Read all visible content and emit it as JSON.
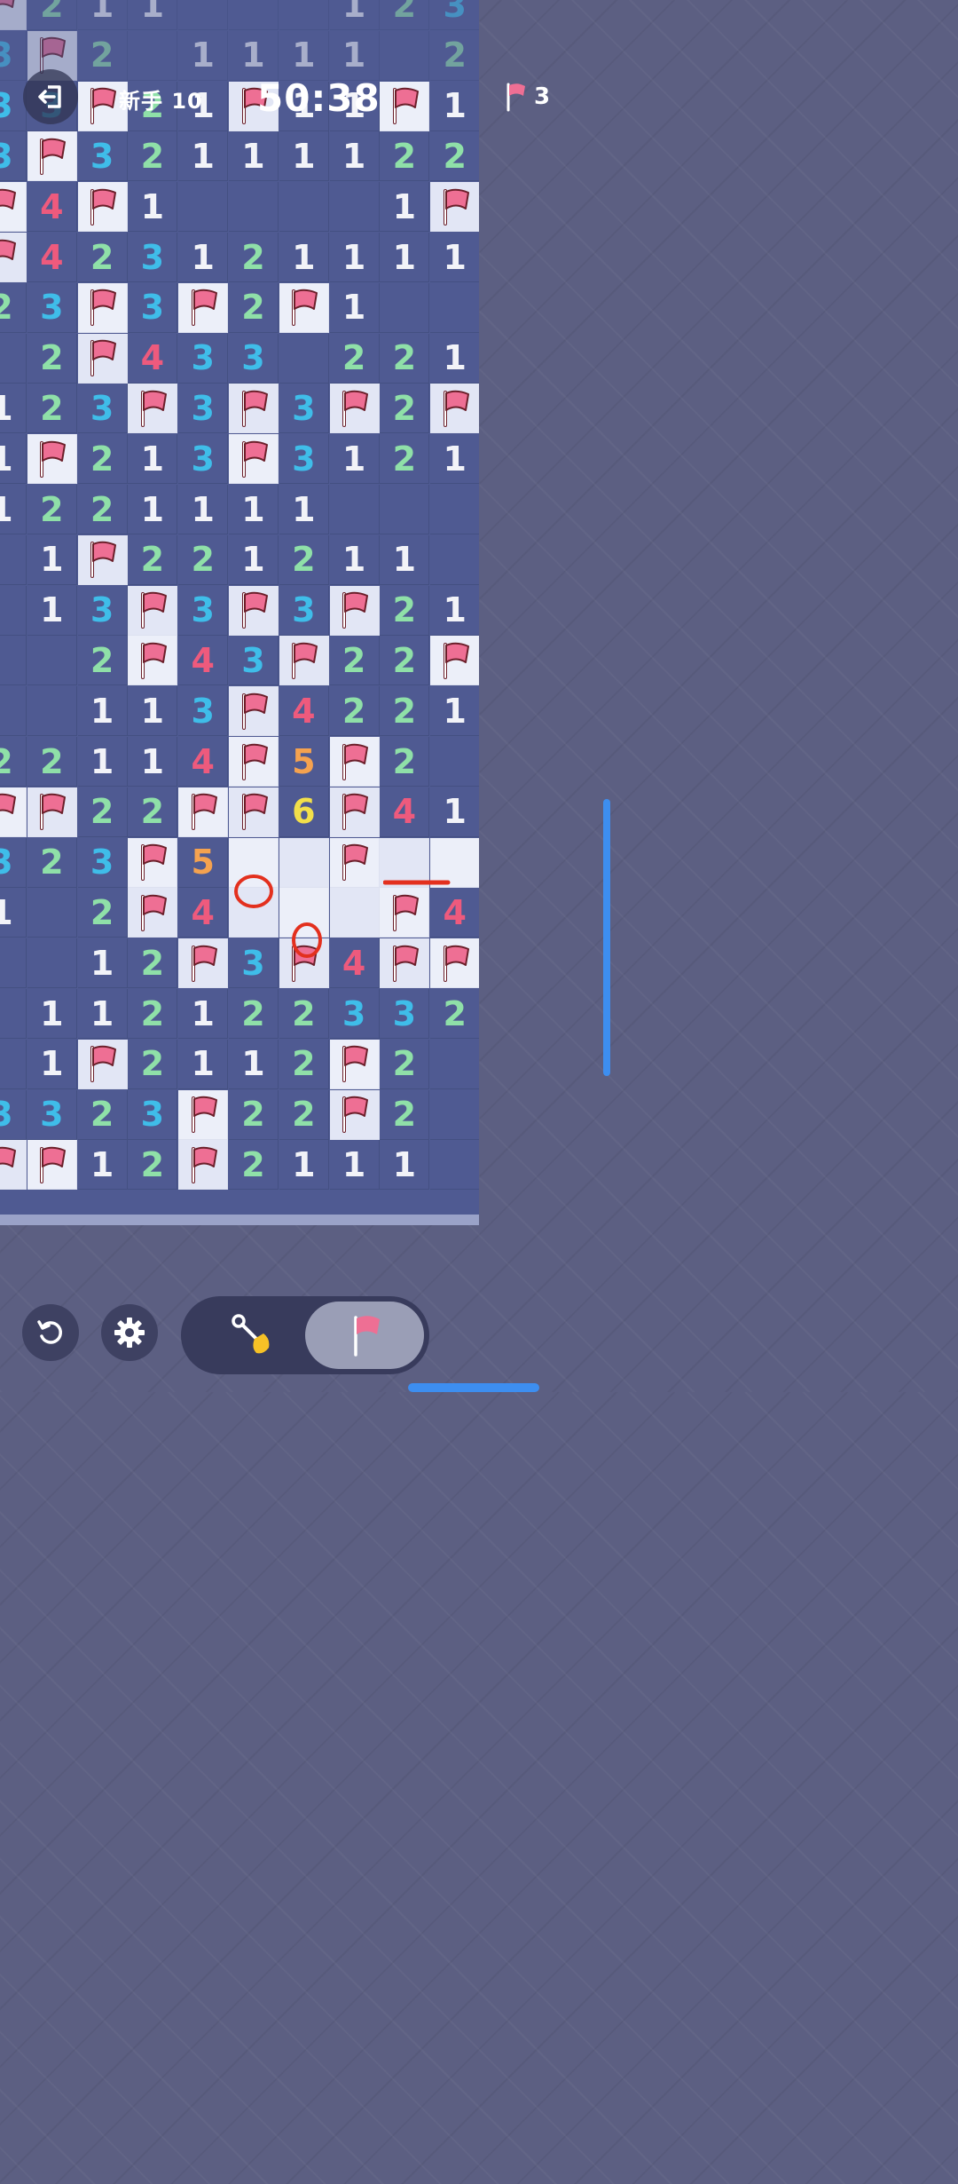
{
  "header": {
    "difficulty": "新手 10",
    "timer": "50:38",
    "flags_remaining": "3"
  },
  "board": {
    "cols": 10,
    "rows": 24,
    "legend": "F = flag, C = unopened cell, . = opened empty, digit = opened number",
    "rows_data": [
      "F211...123F",
      "3F2.1111.22",
      "33F21F11F1",
      "3F32111122",
      "F4F1....1F",
      "F423121111",
      "23F3F2F1..",
      ".2F433.221",
      "123F3F3F2F",
      "1F213F3121",
      "1221111...",
      ".1F221211.",
      ".13F3F3F21",
      "..2F43F22F",
      "..113F4221",
      "22114F5F2.",
      "FF22FF6F41",
      "323F5CCFCC",
      "1.2F4CCCF4",
      "..12F3F4FF",
      ".1121223 32",
      ".1F2112F2.",
      "3323F22F2.",
      "FF12F2111."
    ]
  },
  "annotations": [
    {
      "type": "circle",
      "color": "#e3301e"
    },
    {
      "type": "circle",
      "color": "#e3301e"
    },
    {
      "type": "dash",
      "color": "#e3301e"
    }
  ],
  "toolbar": {
    "restart": "restart",
    "settings": "settings",
    "dig_mode": "dig",
    "flag_mode": "flag"
  },
  "colors": {
    "board": "#4f5a92",
    "unopened": "#eceff9",
    "flag": "#ee6f94",
    "n1": "#f2f3f8",
    "n2": "#8fe0a8",
    "n3": "#3fbde9",
    "n4": "#ee5a7d",
    "n5": "#f5a24f",
    "n6": "#f3e04a",
    "accent": "#3d8ef0"
  }
}
